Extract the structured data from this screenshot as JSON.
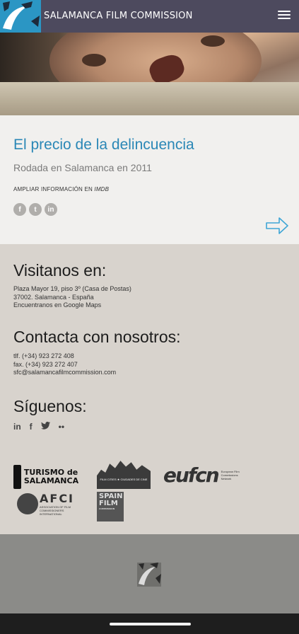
{
  "header": {
    "site_title": "SALAMANCA FILM COMMISSION",
    "menu_icon": "hamburger-menu-icon",
    "brand_color": "#4d4a5e"
  },
  "film": {
    "title": "El precio de la delincuencia",
    "subtitle": "Rodada en Salamanca en 2011",
    "imdb_prefix": "AMPLIAR INFORMACIÓN EN ",
    "imdb_link": "IMDB",
    "share_icons": [
      "facebook-icon",
      "twitter-icon",
      "linkedin-icon"
    ],
    "next_icon": "arrow-right-icon",
    "title_color": "#2a87b6"
  },
  "visit": {
    "heading": "Visitanos en:",
    "address1": "Plaza Mayor 19, piso 3º (Casa de Postas)",
    "address2": "37002. Salamanca - España",
    "maps_link": "Encuentranos en Google Maps"
  },
  "contact": {
    "heading": "Contacta con nosotros:",
    "phone": "tlf. (+34) 923 272 408",
    "fax": "fax. (+34) 923 272 407",
    "email": "sfc@salamancafilmcommission.com"
  },
  "follow": {
    "heading": "Síguenos:",
    "linkedin": "in",
    "facebook": "f",
    "flickr": "••",
    "icons": [
      "linkedin-icon",
      "facebook-icon",
      "twitter-icon",
      "flickr-icon"
    ]
  },
  "partners": {
    "turismo": "TURISMO de SALAMANCA",
    "filmcities": "FILM CITIES ★ CIUDADES DE CINE",
    "eufcn": "eufcn",
    "eufcn_sub": "European Film Commissions Network",
    "afci": "AFCI",
    "afci_sub": "ASSOCIATION OF FILM COMMISSIONERS INTERNATIONAL",
    "spain": "SPAIN FILM",
    "spain_sub": "COMMISSION"
  }
}
